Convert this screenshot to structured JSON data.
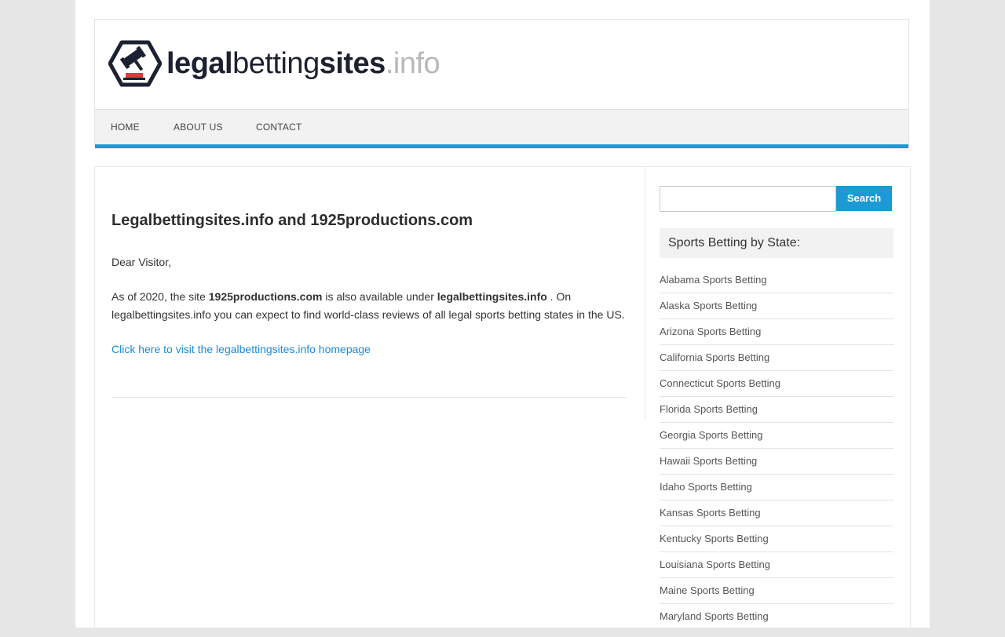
{
  "brand": {
    "logo_bold1": "legal",
    "logo_mid": "betting",
    "logo_bold2": "sites",
    "logo_suffix": ".info"
  },
  "nav": {
    "items": [
      "HOME",
      "ABOUT US",
      "CONTACT"
    ]
  },
  "colors": {
    "accent": "#1b9ad6",
    "link": "#1b8ad6",
    "logo_dark": "#1b2130",
    "logo_red": "#e0393b"
  },
  "article": {
    "title": "Legalbettingsites.info and 1925productions.com",
    "greeting": "Dear Visitor,",
    "body_prefix": "As of 2020, the site ",
    "body_site_old": "1925productions.com",
    "body_mid": " is also available under ",
    "body_site_new": "legalbettingsites.info",
    "body_suffix": " . On legalbettingsites.info you can expect to find world-class reviews of all legal sports betting states in the US.",
    "cta_link": "Click here to visit the legalbettingsites.info homepage"
  },
  "sidebar": {
    "search_placeholder": "",
    "search_button": "Search",
    "widget_title": "Sports Betting by State:",
    "states": [
      "Alabama Sports Betting",
      "Alaska Sports Betting",
      "Arizona Sports Betting",
      "California Sports Betting",
      "Connecticut Sports Betting",
      "Florida Sports Betting",
      "Georgia Sports Betting",
      "Hawaii Sports Betting",
      "Idaho Sports Betting",
      "Kansas Sports Betting",
      "Kentucky Sports Betting",
      "Louisiana Sports Betting",
      "Maine Sports Betting",
      "Maryland Sports Betting"
    ]
  }
}
